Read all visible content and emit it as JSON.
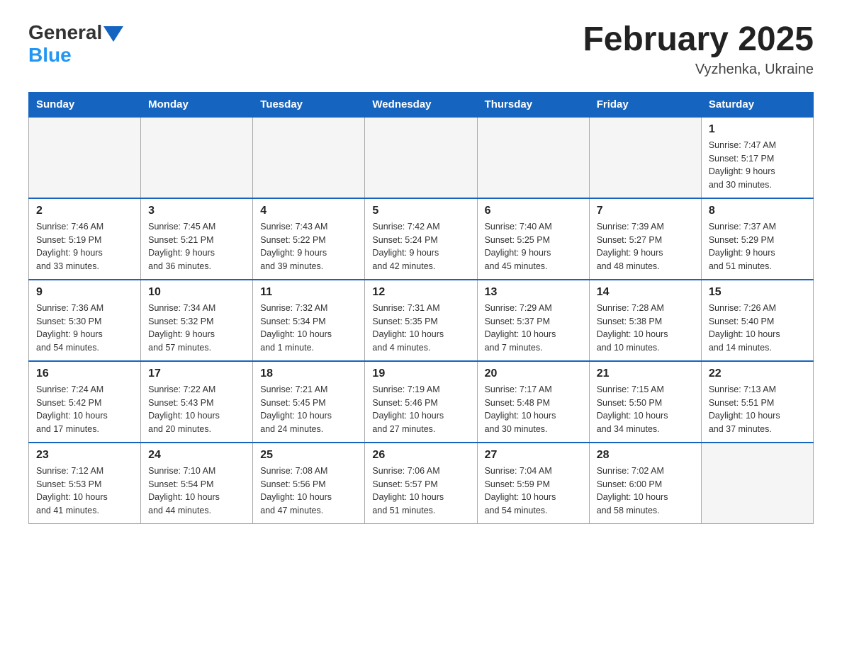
{
  "header": {
    "logo_general": "General",
    "logo_blue": "Blue",
    "title": "February 2025",
    "subtitle": "Vyzhenka, Ukraine"
  },
  "days_of_week": [
    "Sunday",
    "Monday",
    "Tuesday",
    "Wednesday",
    "Thursday",
    "Friday",
    "Saturday"
  ],
  "weeks": [
    [
      {
        "day": "",
        "info": ""
      },
      {
        "day": "",
        "info": ""
      },
      {
        "day": "",
        "info": ""
      },
      {
        "day": "",
        "info": ""
      },
      {
        "day": "",
        "info": ""
      },
      {
        "day": "",
        "info": ""
      },
      {
        "day": "1",
        "info": "Sunrise: 7:47 AM\nSunset: 5:17 PM\nDaylight: 9 hours\nand 30 minutes."
      }
    ],
    [
      {
        "day": "2",
        "info": "Sunrise: 7:46 AM\nSunset: 5:19 PM\nDaylight: 9 hours\nand 33 minutes."
      },
      {
        "day": "3",
        "info": "Sunrise: 7:45 AM\nSunset: 5:21 PM\nDaylight: 9 hours\nand 36 minutes."
      },
      {
        "day": "4",
        "info": "Sunrise: 7:43 AM\nSunset: 5:22 PM\nDaylight: 9 hours\nand 39 minutes."
      },
      {
        "day": "5",
        "info": "Sunrise: 7:42 AM\nSunset: 5:24 PM\nDaylight: 9 hours\nand 42 minutes."
      },
      {
        "day": "6",
        "info": "Sunrise: 7:40 AM\nSunset: 5:25 PM\nDaylight: 9 hours\nand 45 minutes."
      },
      {
        "day": "7",
        "info": "Sunrise: 7:39 AM\nSunset: 5:27 PM\nDaylight: 9 hours\nand 48 minutes."
      },
      {
        "day": "8",
        "info": "Sunrise: 7:37 AM\nSunset: 5:29 PM\nDaylight: 9 hours\nand 51 minutes."
      }
    ],
    [
      {
        "day": "9",
        "info": "Sunrise: 7:36 AM\nSunset: 5:30 PM\nDaylight: 9 hours\nand 54 minutes."
      },
      {
        "day": "10",
        "info": "Sunrise: 7:34 AM\nSunset: 5:32 PM\nDaylight: 9 hours\nand 57 minutes."
      },
      {
        "day": "11",
        "info": "Sunrise: 7:32 AM\nSunset: 5:34 PM\nDaylight: 10 hours\nand 1 minute."
      },
      {
        "day": "12",
        "info": "Sunrise: 7:31 AM\nSunset: 5:35 PM\nDaylight: 10 hours\nand 4 minutes."
      },
      {
        "day": "13",
        "info": "Sunrise: 7:29 AM\nSunset: 5:37 PM\nDaylight: 10 hours\nand 7 minutes."
      },
      {
        "day": "14",
        "info": "Sunrise: 7:28 AM\nSunset: 5:38 PM\nDaylight: 10 hours\nand 10 minutes."
      },
      {
        "day": "15",
        "info": "Sunrise: 7:26 AM\nSunset: 5:40 PM\nDaylight: 10 hours\nand 14 minutes."
      }
    ],
    [
      {
        "day": "16",
        "info": "Sunrise: 7:24 AM\nSunset: 5:42 PM\nDaylight: 10 hours\nand 17 minutes."
      },
      {
        "day": "17",
        "info": "Sunrise: 7:22 AM\nSunset: 5:43 PM\nDaylight: 10 hours\nand 20 minutes."
      },
      {
        "day": "18",
        "info": "Sunrise: 7:21 AM\nSunset: 5:45 PM\nDaylight: 10 hours\nand 24 minutes."
      },
      {
        "day": "19",
        "info": "Sunrise: 7:19 AM\nSunset: 5:46 PM\nDaylight: 10 hours\nand 27 minutes."
      },
      {
        "day": "20",
        "info": "Sunrise: 7:17 AM\nSunset: 5:48 PM\nDaylight: 10 hours\nand 30 minutes."
      },
      {
        "day": "21",
        "info": "Sunrise: 7:15 AM\nSunset: 5:50 PM\nDaylight: 10 hours\nand 34 minutes."
      },
      {
        "day": "22",
        "info": "Sunrise: 7:13 AM\nSunset: 5:51 PM\nDaylight: 10 hours\nand 37 minutes."
      }
    ],
    [
      {
        "day": "23",
        "info": "Sunrise: 7:12 AM\nSunset: 5:53 PM\nDaylight: 10 hours\nand 41 minutes."
      },
      {
        "day": "24",
        "info": "Sunrise: 7:10 AM\nSunset: 5:54 PM\nDaylight: 10 hours\nand 44 minutes."
      },
      {
        "day": "25",
        "info": "Sunrise: 7:08 AM\nSunset: 5:56 PM\nDaylight: 10 hours\nand 47 minutes."
      },
      {
        "day": "26",
        "info": "Sunrise: 7:06 AM\nSunset: 5:57 PM\nDaylight: 10 hours\nand 51 minutes."
      },
      {
        "day": "27",
        "info": "Sunrise: 7:04 AM\nSunset: 5:59 PM\nDaylight: 10 hours\nand 54 minutes."
      },
      {
        "day": "28",
        "info": "Sunrise: 7:02 AM\nSunset: 6:00 PM\nDaylight: 10 hours\nand 58 minutes."
      },
      {
        "day": "",
        "info": ""
      }
    ]
  ]
}
